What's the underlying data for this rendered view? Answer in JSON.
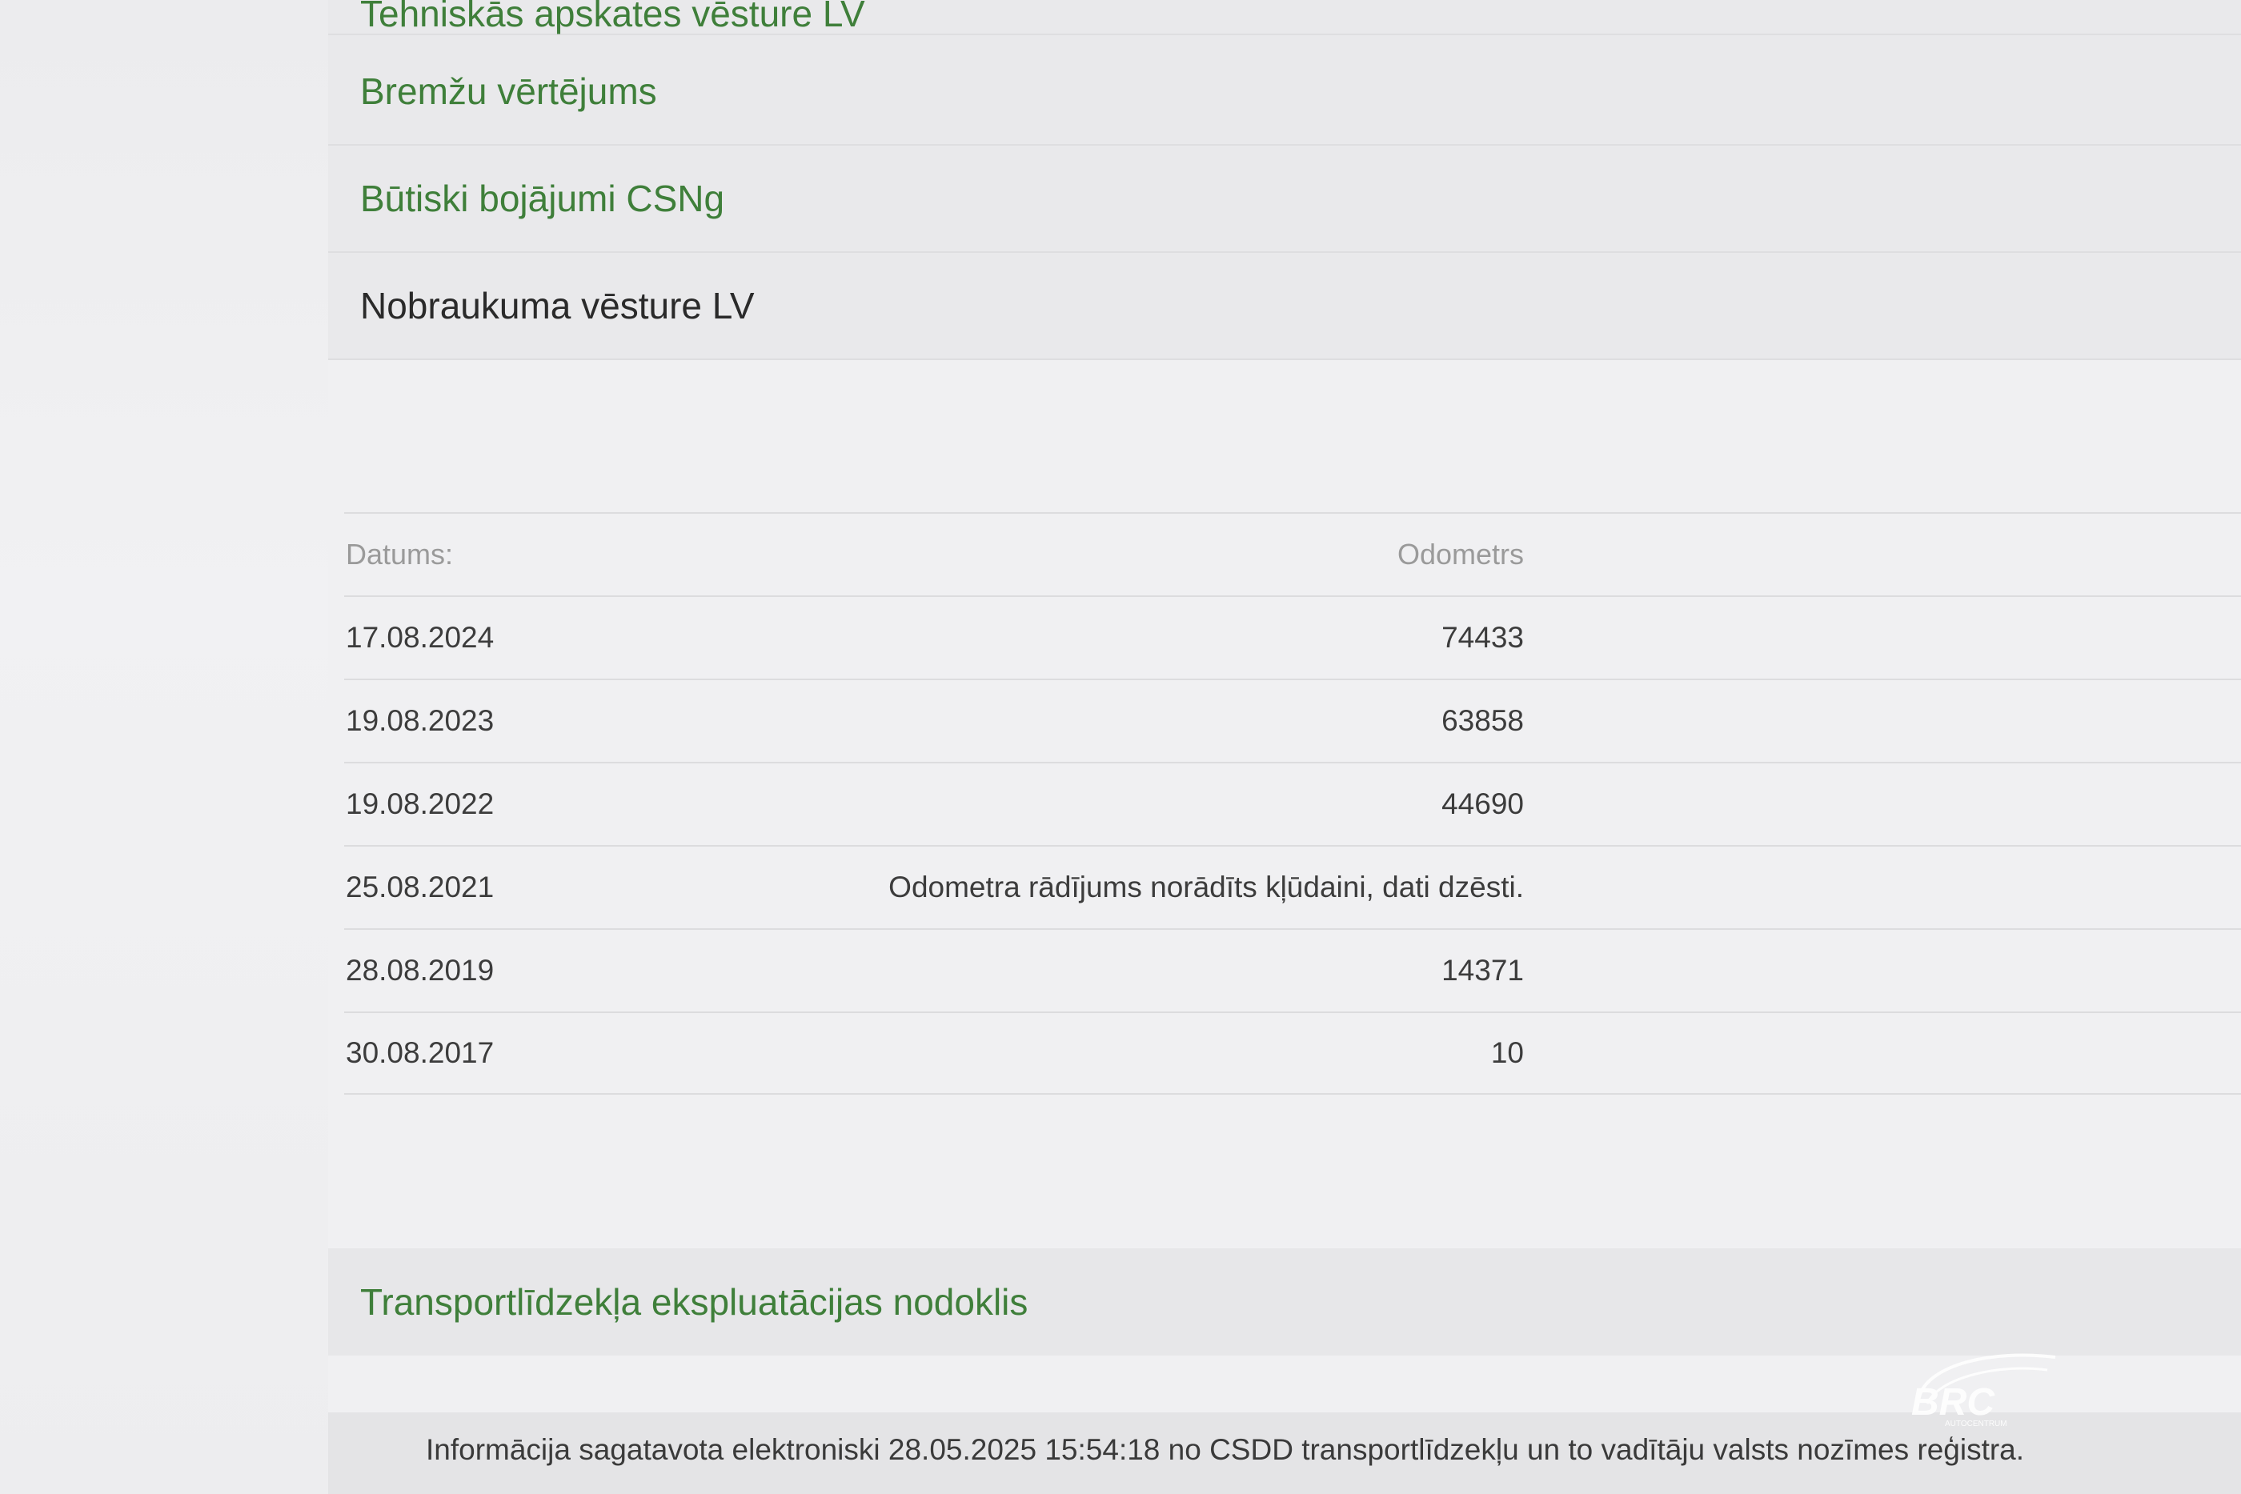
{
  "menu": {
    "partial_item_label": "Tehniskās apskates vēsture LV",
    "items": [
      {
        "label": "Bremžu vērtējums"
      },
      {
        "label": "Būtiski bojājumi CSNg"
      },
      {
        "label": "Nobraukuma vēsture LV"
      }
    ]
  },
  "odometer_table": {
    "headers": {
      "date": "Datums:",
      "odometer": "Odometrs"
    },
    "rows": [
      {
        "date": "17.08.2024",
        "odometer": "74433"
      },
      {
        "date": "19.08.2023",
        "odometer": "63858"
      },
      {
        "date": "19.08.2022",
        "odometer": "44690"
      },
      {
        "date": "25.08.2021",
        "odometer": "Odometra rādījums norādīts kļūdaini, dati dzēsti."
      },
      {
        "date": "28.08.2019",
        "odometer": "14371"
      },
      {
        "date": "30.08.2017",
        "odometer": "10"
      }
    ]
  },
  "tax_section": {
    "label": "Transportlīdzekļa ekspluatācijas nodoklis"
  },
  "footer": {
    "text": "Informācija sagatavota elektroniski 28.05.2025 15:54:18 no CSDD transportlīdzekļu un to vadītāju valsts nozīmes reģistra."
  },
  "watermark": {
    "brand": "BRC",
    "sub": "AUTOCENTRUM"
  },
  "colors": {
    "link_green": "#3f7f3a",
    "active_text": "#2a2a2a"
  }
}
